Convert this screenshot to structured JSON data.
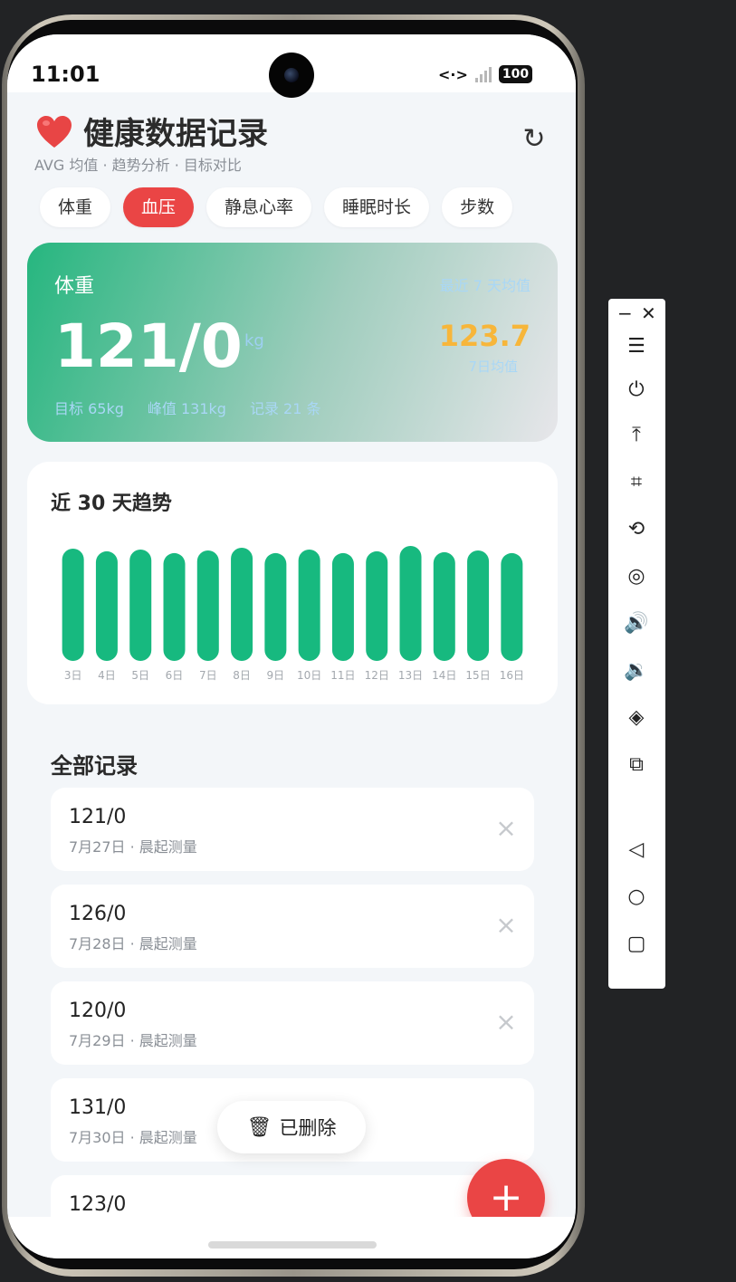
{
  "status_bar": {
    "time": "11:01",
    "battery": "100"
  },
  "header": {
    "title": "健康数据记录",
    "subtitle": "AVG 均值 · 趋势分析 · 目标对比"
  },
  "tabs": [
    {
      "label": "体重",
      "active": false
    },
    {
      "label": "血压",
      "active": true
    },
    {
      "label": "静息心率",
      "active": false
    },
    {
      "label": "睡眠时长",
      "active": false
    },
    {
      "label": "步数",
      "active": false
    }
  ],
  "summary": {
    "title": "体重",
    "period": "最近 7 天均值",
    "value": "121/0",
    "unit": "kg",
    "avg_value": "123.7",
    "avg_label": "7日均值",
    "target": "目标 65kg",
    "peak": "峰值 131kg",
    "count": "记录 21 条"
  },
  "trend": {
    "title": "近 30 天趋势"
  },
  "chart_data": {
    "type": "bar",
    "categories": [
      "3日",
      "4日",
      "5日",
      "6日",
      "7日",
      "8日",
      "9日",
      "10日",
      "11日",
      "12日",
      "13日",
      "14日",
      "15日",
      "16日"
    ],
    "values": [
      125,
      122,
      124,
      120,
      123,
      126,
      120,
      124,
      120,
      122,
      128,
      121,
      123,
      120
    ],
    "title": "近 30 天趋势",
    "xlabel": "",
    "ylabel": "",
    "ylim": [
      0,
      131
    ],
    "color": "#17b97f"
  },
  "records_section": {
    "title": "全部记录"
  },
  "records": [
    {
      "value": "121/0",
      "meta": "7月27日 · 晨起测量"
    },
    {
      "value": "126/0",
      "meta": "7月28日 · 晨起测量"
    },
    {
      "value": "120/0",
      "meta": "7月29日 · 晨起测量"
    },
    {
      "value": "131/0",
      "meta": "7月30日 · 晨起测量"
    },
    {
      "value": "123/0",
      "meta": ""
    }
  ],
  "toast": {
    "label": "已删除"
  },
  "fab": {
    "label": "+"
  },
  "colors": {
    "accent_red": "#ea4545",
    "bar_green": "#17b97f",
    "avg_amber": "#f7b63a"
  },
  "toolbar": {
    "items": [
      "menu-icon",
      "power-icon",
      "pin-top-icon",
      "crop-icon",
      "rotate-icon",
      "screenshot-icon",
      "volume-up-icon",
      "volume-down-icon",
      "shake-icon",
      "devices-icon",
      "back-icon",
      "home-icon",
      "recents-icon"
    ]
  }
}
